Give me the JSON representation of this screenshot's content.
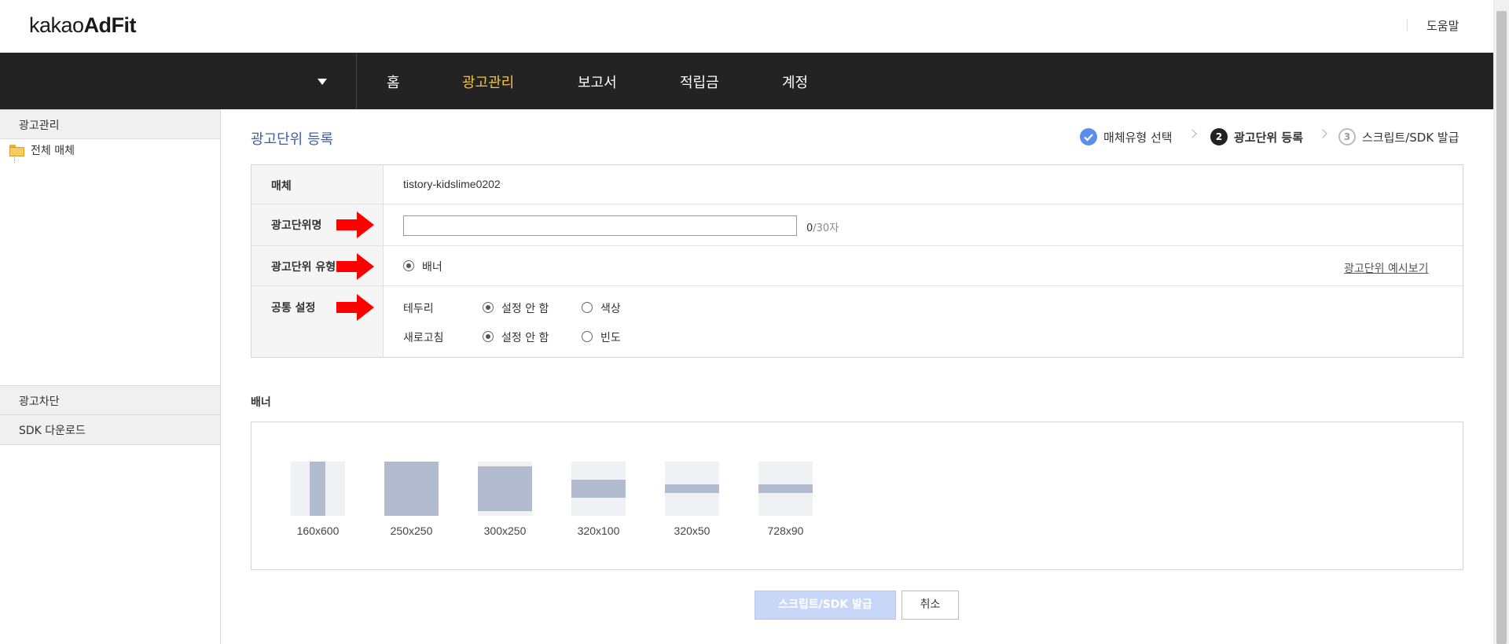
{
  "logo": {
    "prefix": "kakao",
    "bold": "AdFit"
  },
  "header": {
    "help": "도움말"
  },
  "nav": {
    "items": [
      {
        "label": "홈",
        "active": false
      },
      {
        "label": "광고관리",
        "active": true
      },
      {
        "label": "보고서",
        "active": false
      },
      {
        "label": "적립금",
        "active": false
      },
      {
        "label": "계정",
        "active": false
      }
    ]
  },
  "sidebar": {
    "section1": "광고관리",
    "tree_item": "전체 매체",
    "section2": "광고차단",
    "section3": "SDK 다운로드"
  },
  "main": {
    "title": "광고단위 등록",
    "steps": [
      {
        "num": "",
        "label": "매체유형 선택",
        "state": "done"
      },
      {
        "num": "2",
        "label": "광고단위 등록",
        "state": "current"
      },
      {
        "num": "3",
        "label": "스크립트/SDK 발급",
        "state": "pending"
      }
    ],
    "form": {
      "media_label": "매체",
      "media_value": "tistory-kidslime0202",
      "name_label": "광고단위명",
      "name_value": "",
      "name_count": "0",
      "name_max": "/30자",
      "type_label": "광고단위 유형",
      "type_option": "배너",
      "preview_link": "광고단위 예시보기",
      "common_label": "공통 설정",
      "border_label": "테두리",
      "border_opt1": "설정 안 함",
      "border_opt2": "색상",
      "refresh_label": "새로고침",
      "refresh_opt1": "설정 안 함",
      "refresh_opt2": "빈도"
    },
    "banner_section": "배너",
    "banners": [
      "160x600",
      "250x250",
      "300x250",
      "320x100",
      "320x50",
      "728x90"
    ],
    "buttons": {
      "issue": "스크립트/SDK 발급",
      "cancel": "취소"
    }
  },
  "colors": {
    "nav_bg": "#232323",
    "nav_active": "#f5c338",
    "title_blue": "#3f5ea8",
    "step_done": "#5b8def",
    "arrow": "#ff0000",
    "banner_fill": "#b2bbd0"
  }
}
